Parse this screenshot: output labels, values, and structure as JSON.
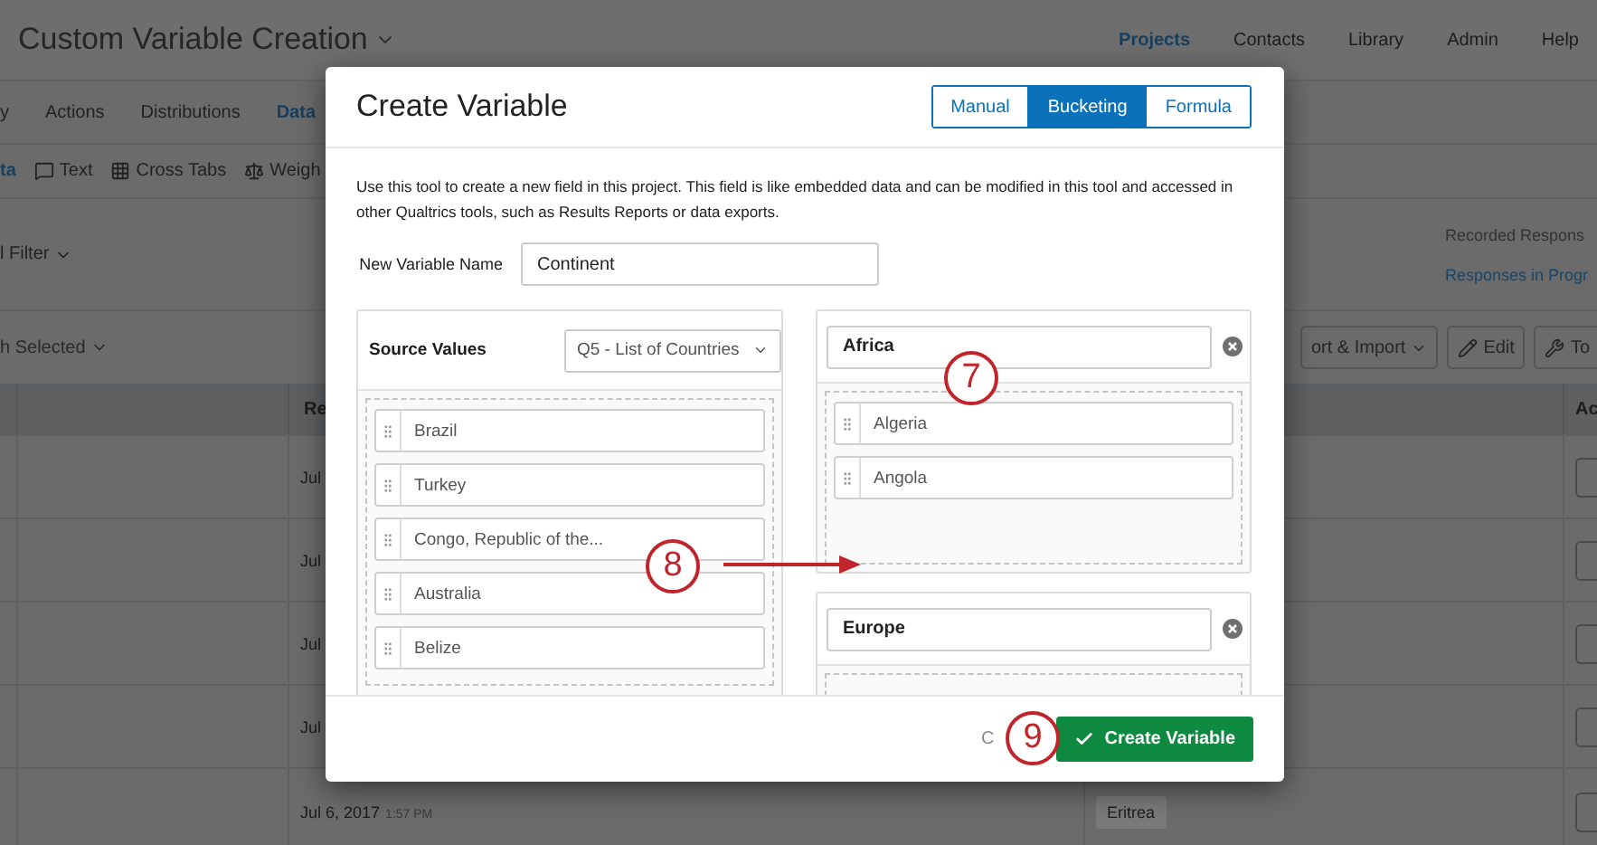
{
  "page": {
    "title": "Custom Variable Creation",
    "nav": [
      {
        "label": "Projects",
        "selected": true
      },
      {
        "label": "Contacts",
        "selected": false
      },
      {
        "label": "Library",
        "selected": false
      },
      {
        "label": "Admin",
        "selected": false
      },
      {
        "label": "Help",
        "selected": false
      }
    ],
    "tabs": [
      {
        "label": "y",
        "selected": false
      },
      {
        "label": "Actions",
        "selected": false
      },
      {
        "label": "Distributions",
        "selected": false
      },
      {
        "label": "Data",
        "selected": true
      }
    ],
    "subtabs": [
      {
        "label": "ta",
        "kind": "plain",
        "selected": true
      },
      {
        "label": "Text",
        "kind": "text",
        "selected": false
      },
      {
        "label": "Cross Tabs",
        "kind": "crosstabs",
        "selected": false
      },
      {
        "label": "Weigh",
        "kind": "weighting",
        "selected": false
      }
    ],
    "filter": "l Filter",
    "recorded": "Recorded Respons",
    "in_progress": "Responses in Progr",
    "selection": "h Selected",
    "toolbar": [
      {
        "label": "ort & Import",
        "kind": "dropdown"
      },
      {
        "label": "Edit",
        "kind": "edit"
      },
      {
        "label": "To",
        "kind": "tools"
      }
    ],
    "table": {
      "columns": [
        "Re",
        "Ac"
      ],
      "rows": [
        {
          "date": "Jul"
        },
        {
          "date": "Jul"
        },
        {
          "date": "Jul"
        },
        {
          "date": "Jul"
        },
        {
          "date": "Jul 6, 2017",
          "time": "1:57 PM",
          "answer": "Eritrea"
        }
      ]
    }
  },
  "dialog": {
    "title": "Create Variable",
    "modes": [
      {
        "label": "Manual",
        "selected": false
      },
      {
        "label": "Bucketing",
        "selected": true
      },
      {
        "label": "Formula",
        "selected": false
      }
    ],
    "description": "Use this tool to create a new field in this project. This field is like embedded data and can be modified in this tool and accessed in other Qualtrics tools, such as Results Reports or data exports.",
    "name_label": "New Variable Name",
    "name_value": "Continent",
    "source": {
      "label": "Source Values",
      "question": "Q5 - List of Countries",
      "values": [
        "Brazil",
        "Turkey",
        "Congo, Republic of the...",
        "Australia",
        "Belize"
      ]
    },
    "buckets": [
      {
        "name": "Africa",
        "values": [
          "Algeria",
          "Angola"
        ]
      },
      {
        "name": "Europe"
      }
    ],
    "cancel": "C",
    "submit": "Create Variable"
  },
  "annotations": [
    {
      "number": "7"
    },
    {
      "number": "8"
    },
    {
      "number": "9"
    }
  ]
}
